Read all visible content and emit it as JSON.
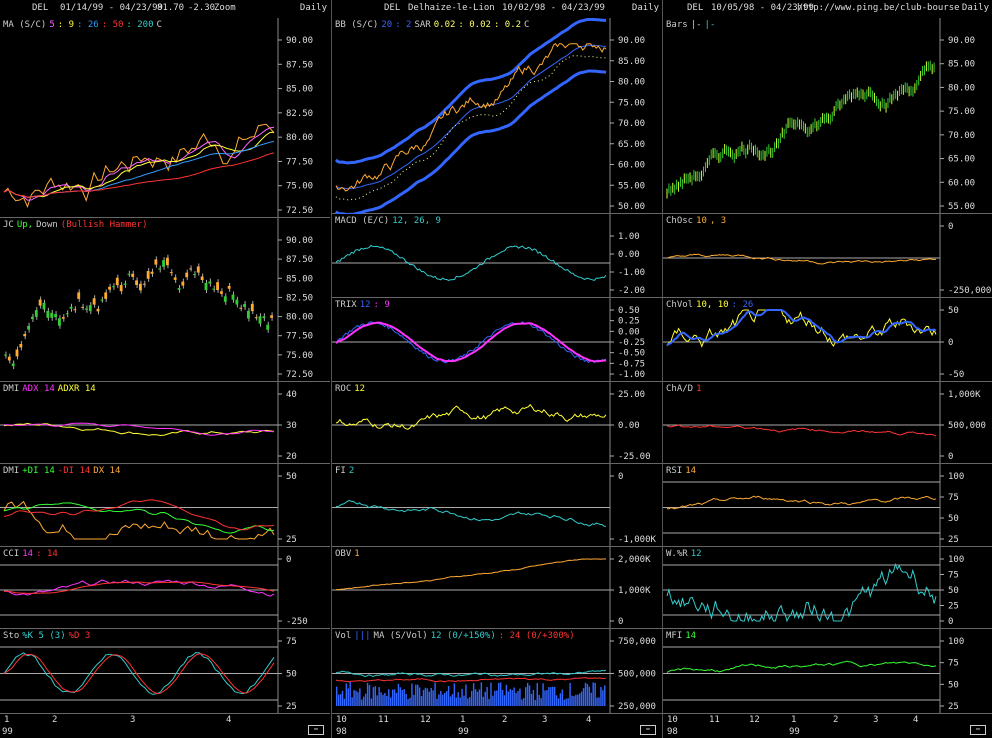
{
  "columns": [
    {
      "header": {
        "symbol": "DEL",
        "range": "01/14/99 - 04/23/99",
        "last": "81.70",
        "change": "-2.30",
        "mode": "Zoom",
        "period": "Daily"
      },
      "panels": [
        {
          "id": "ma",
          "labels": [
            {
              "t": "MA (S/C)",
              "c": "#ccc"
            },
            {
              "t": "5",
              "c": "#ff66ff"
            },
            {
              "t": ": 9",
              "c": "#ffff33"
            },
            {
              "t": ": 26",
              "c": "#3399ff"
            },
            {
              "t": ": 50",
              "c": "#ff3333"
            },
            {
              "t": ": 200",
              "c": "#33cccc"
            },
            {
              "t": "C",
              "c": "#ccc"
            }
          ],
          "ticks": [
            "90.00",
            "87.50",
            "85.00",
            "82.50",
            "80.00",
            "77.50",
            "75.00",
            "72.50"
          ]
        },
        {
          "id": "jc",
          "labels": [
            {
              "t": "JC",
              "c": "#ccc"
            },
            {
              "t": "Up,",
              "c": "#33ff33"
            },
            {
              "t": "Down",
              "c": "#ccc"
            },
            {
              "t": "(Bullish Hammer)",
              "c": "#ff3333"
            }
          ],
          "ticks": [
            "90.00",
            "87.50",
            "85.00",
            "82.50",
            "80.00",
            "77.50",
            "75.00",
            "72.50"
          ]
        },
        {
          "id": "dmi1",
          "labels": [
            {
              "t": "DMI",
              "c": "#ccc"
            },
            {
              "t": "ADX 14",
              "c": "#ff33ff"
            },
            {
              "t": "ADXR 14",
              "c": "#ffff33"
            }
          ],
          "ticks": [
            "40",
            "30",
            "20"
          ]
        },
        {
          "id": "dmi2",
          "labels": [
            {
              "t": "DMI",
              "c": "#ccc"
            },
            {
              "t": "+DI 14",
              "c": "#33ff33"
            },
            {
              "t": "-DI 14",
              "c": "#ff3333"
            },
            {
              "t": "DX 14",
              "c": "#ffaa33"
            }
          ],
          "ticks": [
            "50",
            "25"
          ]
        },
        {
          "id": "cci",
          "labels": [
            {
              "t": "CCI",
              "c": "#ccc"
            },
            {
              "t": "14",
              "c": "#ff33ff"
            },
            {
              "t": ": 14",
              "c": "#ff3333"
            }
          ],
          "ticks": [
            "0",
            "-250"
          ]
        },
        {
          "id": "sto",
          "labels": [
            {
              "t": "Sto",
              "c": "#ccc"
            },
            {
              "t": "%K 5 (3)",
              "c": "#33cccc"
            },
            {
              "t": "%D 3",
              "c": "#ff3333"
            }
          ],
          "ticks": [
            "75",
            "50",
            "25"
          ]
        }
      ],
      "xaxis": {
        "labels": [
          "1",
          "2",
          "3",
          "4"
        ],
        "year": "99"
      }
    },
    {
      "header": {
        "symbol": "DEL",
        "name": "Delhaize-le-Lion",
        "range": "10/02/98 - 04/23/99",
        "period": "Daily"
      },
      "panels": [
        {
          "id": "bb",
          "labels": [
            {
              "t": "BB (S/C)",
              "c": "#ccc"
            },
            {
              "t": "20",
              "c": "#3366ff"
            },
            {
              "t": ": 2",
              "c": "#3366ff"
            },
            {
              "t": "SAR",
              "c": "#ccc"
            },
            {
              "t": "0.02",
              "c": "#ffff66"
            },
            {
              "t": ": 0.02",
              "c": "#ffff66"
            },
            {
              "t": ": 0.2",
              "c": "#ffff66"
            },
            {
              "t": "C",
              "c": "#ccc"
            }
          ],
          "ticks": [
            "90.00",
            "85.00",
            "80.00",
            "75.00",
            "70.00",
            "65.00",
            "60.00",
            "55.00",
            "50.00"
          ]
        },
        {
          "id": "macd",
          "labels": [
            {
              "t": "MACD (E/C)",
              "c": "#ccc"
            },
            {
              "t": "12, 26, 9",
              "c": "#33cccc"
            }
          ],
          "ticks": [
            "1.00",
            "0.00",
            "-1.00",
            "-2.00"
          ]
        },
        {
          "id": "trix",
          "labels": [
            {
              "t": "TRIX",
              "c": "#ccc"
            },
            {
              "t": "12",
              "c": "#3366ff"
            },
            {
              "t": ": 9",
              "c": "#ff33ff"
            }
          ],
          "ticks": [
            "0.50",
            "0.25",
            "0.00",
            "-0.25",
            "-0.50",
            "-0.75",
            "-1.00"
          ]
        },
        {
          "id": "roc",
          "labels": [
            {
              "t": "ROC",
              "c": "#ccc"
            },
            {
              "t": "12",
              "c": "#ffff33"
            }
          ],
          "ticks": [
            "25.00",
            "0.00",
            "-25.00"
          ]
        },
        {
          "id": "fi",
          "labels": [
            {
              "t": "FI",
              "c": "#ccc"
            },
            {
              "t": "2",
              "c": "#33cccc"
            }
          ],
          "ticks": [
            "0",
            "-1,000K"
          ]
        },
        {
          "id": "obv",
          "labels": [
            {
              "t": "OBV",
              "c": "#ccc"
            },
            {
              "t": "1",
              "c": "#ffaa33"
            }
          ],
          "ticks": [
            "2,000K",
            "1,000K",
            "0"
          ]
        },
        {
          "id": "vol",
          "labels": [
            {
              "t": "Vol",
              "c": "#ccc"
            },
            {
              "t": "|||",
              "c": "#3366ff"
            },
            {
              "t": "MA (S/Vol)",
              "c": "#ccc"
            },
            {
              "t": "12 (0/+150%)",
              "c": "#33cccc"
            },
            {
              "t": ": 24 (0/+300%)",
              "c": "#ff3333"
            }
          ],
          "ticks": [
            "750,000",
            "500,000",
            "250,000"
          ]
        }
      ],
      "xaxis": {
        "labels": [
          "10",
          "11",
          "12",
          "1",
          "2",
          "3",
          "4"
        ],
        "year1": "98",
        "year2": "99"
      }
    },
    {
      "header": {
        "symbol": "DEL",
        "range": "10/05/98 - 04/23/99",
        "url": "http://www.ping.be/club-bourse",
        "period": "Daily"
      },
      "panels": [
        {
          "id": "bars",
          "labels": [
            {
              "t": "Bars",
              "c": "#ccc"
            },
            {
              "t": "|-",
              "c": "#ccc"
            },
            {
              "t": "|-",
              "c": "#33cccc"
            }
          ],
          "ticks": [
            "90.00",
            "85.00",
            "80.00",
            "75.00",
            "70.00",
            "65.00",
            "60.00",
            "55.00"
          ]
        },
        {
          "id": "chosc",
          "labels": [
            {
              "t": "ChOsc",
              "c": "#ccc"
            },
            {
              "t": "10",
              "c": "#ffaa33"
            },
            {
              "t": ", 3",
              "c": "#ffaa33"
            }
          ],
          "ticks": [
            "0",
            "-250,000"
          ]
        },
        {
          "id": "chvol",
          "labels": [
            {
              "t": "ChVol",
              "c": "#ccc"
            },
            {
              "t": "10, 10",
              "c": "#ffff33"
            },
            {
              "t": ": 26",
              "c": "#3366ff"
            }
          ],
          "ticks": [
            "50",
            "0",
            "-50"
          ]
        },
        {
          "id": "chad",
          "labels": [
            {
              "t": "ChA/D",
              "c": "#ccc"
            },
            {
              "t": "1",
              "c": "#ff3333"
            }
          ],
          "ticks": [
            "1,000K",
            "500,000",
            "0"
          ]
        },
        {
          "id": "rsi",
          "labels": [
            {
              "t": "RSI",
              "c": "#ccc"
            },
            {
              "t": "14",
              "c": "#ffaa33"
            }
          ],
          "ticks": [
            "100",
            "75",
            "50",
            "25"
          ]
        },
        {
          "id": "wr",
          "labels": [
            {
              "t": "W.%R",
              "c": "#ccc"
            },
            {
              "t": "12",
              "c": "#33cccc"
            }
          ],
          "ticks": [
            "100",
            "75",
            "50",
            "25",
            "0"
          ]
        },
        {
          "id": "mfi",
          "labels": [
            {
              "t": "MFI",
              "c": "#ccc"
            },
            {
              "t": "14",
              "c": "#33ff33"
            }
          ],
          "ticks": [
            "100",
            "75",
            "50",
            "25"
          ]
        }
      ],
      "xaxis": {
        "labels": [
          "10",
          "11",
          "12",
          "1",
          "2",
          "3",
          "4"
        ],
        "year1": "98",
        "year2": "99"
      }
    }
  ]
}
